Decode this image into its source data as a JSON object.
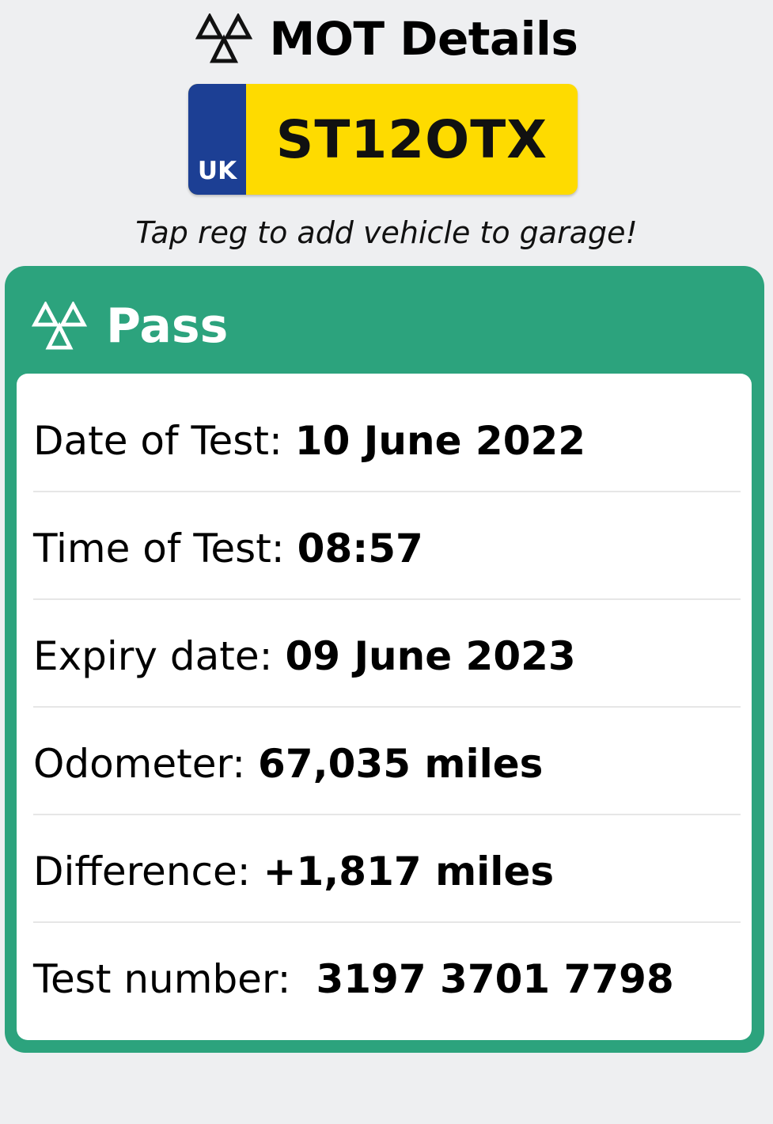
{
  "header": {
    "title": "MOT Details",
    "icon": "mot-triangles-icon"
  },
  "plate": {
    "country": "UK",
    "registration": "ST12OTX",
    "colors": {
      "band": "#1c3f94",
      "plate": "#fedb00"
    }
  },
  "hint": "Tap reg to add vehicle to garage!",
  "result": {
    "status": "Pass",
    "icon": "mot-triangles-icon",
    "status_color": "#2ca37d",
    "rows": [
      {
        "label": "Date of Test:",
        "value": "10 June 2022"
      },
      {
        "label": "Time of Test:",
        "value": "08:57"
      },
      {
        "label": "Expiry date:",
        "value": "09 June 2023"
      },
      {
        "label": "Odometer:",
        "value": "67,035 miles"
      },
      {
        "label": "Difference:",
        "value": "+1,817 miles"
      },
      {
        "label": "Test number:",
        "value": "3197 3701 7798"
      }
    ]
  }
}
